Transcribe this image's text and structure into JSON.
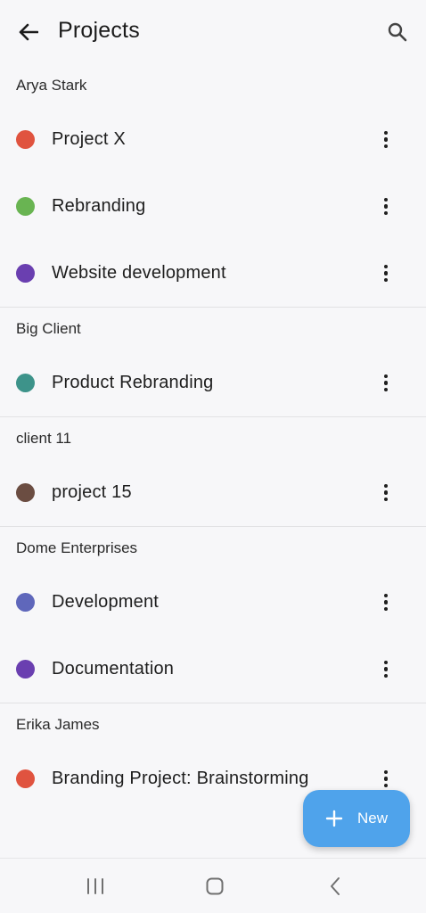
{
  "header": {
    "title": "Projects",
    "back_icon": "arrow-left-icon",
    "search_icon": "search-icon"
  },
  "groups": [
    {
      "name": "Arya Stark",
      "projects": [
        {
          "label": "Project X",
          "color": "#e0533f"
        },
        {
          "label": "Rebranding",
          "color": "#69b452"
        },
        {
          "label": "Website development",
          "color": "#6a3fb0"
        }
      ]
    },
    {
      "name": "Big Client",
      "projects": [
        {
          "label": "Product Rebranding",
          "color": "#3d938a"
        }
      ]
    },
    {
      "name": "client 11",
      "projects": [
        {
          "label": "project 15",
          "color": "#6b4d42"
        }
      ]
    },
    {
      "name": "Dome Enterprises",
      "projects": [
        {
          "label": "Development",
          "color": "#5f67bb"
        },
        {
          "label": "Documentation",
          "color": "#6a3fb0"
        }
      ]
    },
    {
      "name": "Erika James",
      "projects": [
        {
          "label": "Branding Project: Brainstorming",
          "color": "#e0533f"
        }
      ]
    }
  ],
  "fab": {
    "label": "New",
    "icon": "plus-icon",
    "color": "#4fa3eb"
  },
  "system_nav": {
    "recents_icon": "recents-icon",
    "home_icon": "home-icon",
    "back_icon": "nav-back-icon"
  }
}
